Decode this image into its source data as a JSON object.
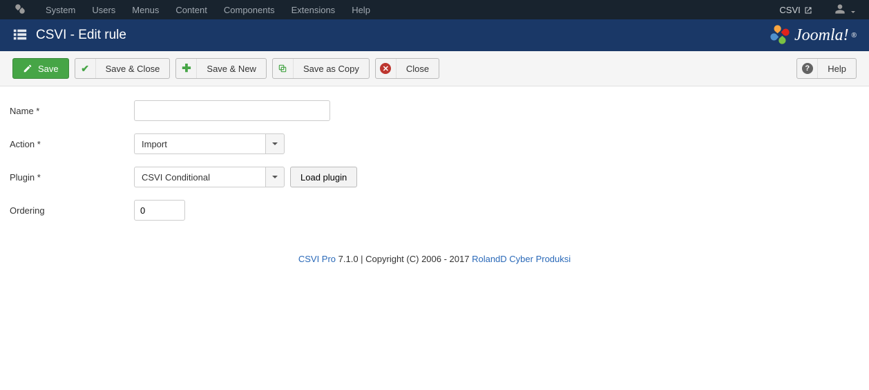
{
  "topmenu": {
    "items": [
      "System",
      "Users",
      "Menus",
      "Content",
      "Components",
      "Extensions",
      "Help"
    ],
    "right_link": "CSVI"
  },
  "header": {
    "title": "CSVI - Edit rule",
    "brand": "Joomla!"
  },
  "toolbar": {
    "save": "Save",
    "save_close": "Save & Close",
    "save_new": "Save & New",
    "save_copy": "Save as Copy",
    "close": "Close",
    "help": "Help"
  },
  "form": {
    "name_label": "Name *",
    "name_value": "",
    "action_label": "Action *",
    "action_value": "Import",
    "plugin_label": "Plugin *",
    "plugin_value": "CSVI Conditional",
    "load_plugin": "Load plugin",
    "ordering_label": "Ordering",
    "ordering_value": "0"
  },
  "footer": {
    "link1": "CSVI Pro",
    "mid": " 7.1.0 | Copyright (C) 2006 - 2017 ",
    "link2": "RolandD Cyber Produksi"
  }
}
